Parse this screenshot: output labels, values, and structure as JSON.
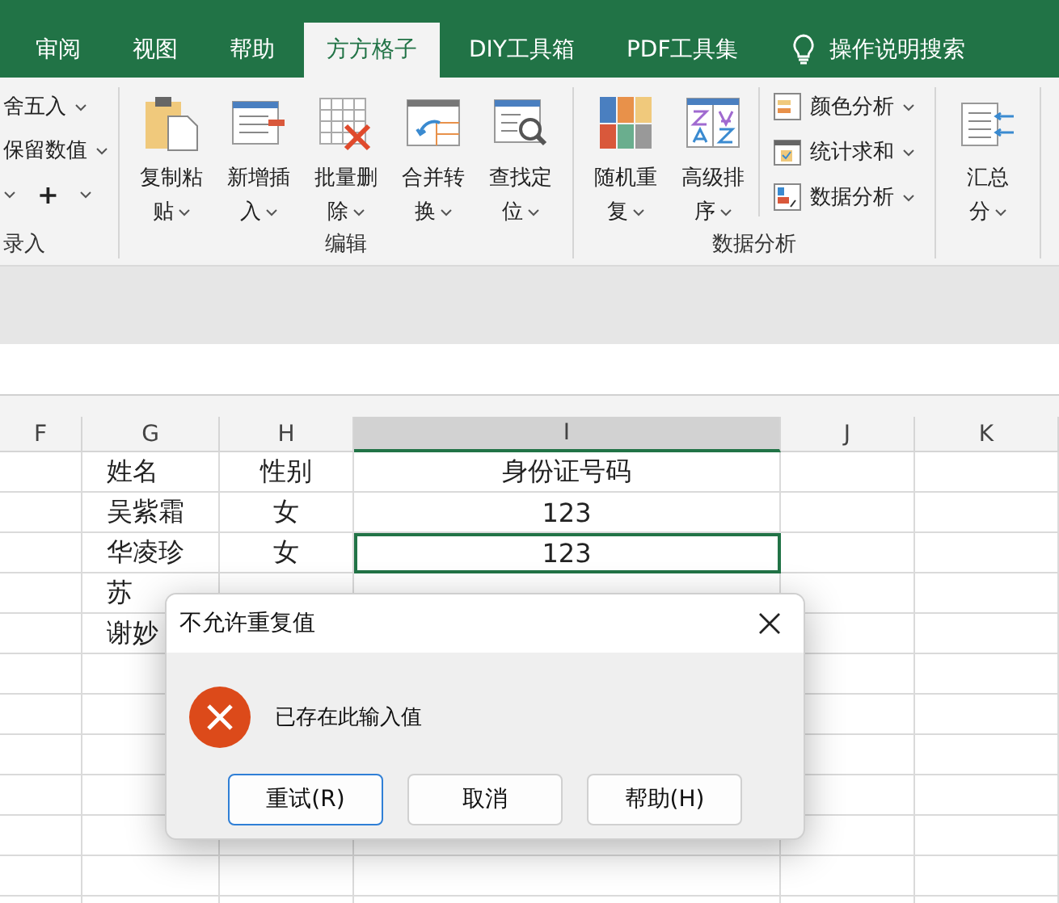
{
  "tabs": [
    {
      "label": "审阅",
      "selected": false
    },
    {
      "label": "视图",
      "selected": false
    },
    {
      "label": "帮助",
      "selected": false
    },
    {
      "label": "方方格子",
      "selected": true
    },
    {
      "label": "DIY工具箱",
      "selected": false
    },
    {
      "label": "PDF工具集",
      "selected": false
    }
  ],
  "search": {
    "label": "操作说明搜索"
  },
  "ribbon": {
    "groups": [
      {
        "label": "录入",
        "items": [
          {
            "kind": "small",
            "label": "舍五入"
          },
          {
            "kind": "small",
            "label": "保留数值"
          },
          {
            "kind": "symbol",
            "label": "+"
          }
        ]
      },
      {
        "label": "编辑",
        "items": [
          {
            "kind": "large",
            "lines": [
              "复制粘",
              "贴"
            ]
          },
          {
            "kind": "large",
            "lines": [
              "新增插",
              "入"
            ]
          },
          {
            "kind": "large",
            "lines": [
              "批量删",
              "除"
            ]
          },
          {
            "kind": "large",
            "lines": [
              "合并转",
              "换"
            ]
          },
          {
            "kind": "large",
            "lines": [
              "查找定",
              "位"
            ]
          }
        ]
      },
      {
        "label": "数据分析",
        "items": [
          {
            "kind": "large",
            "lines": [
              "随机重",
              "复"
            ]
          },
          {
            "kind": "large",
            "lines": [
              "高级排",
              "序"
            ]
          },
          {
            "kind": "stack",
            "items": [
              {
                "label": "颜色分析"
              },
              {
                "label": "统计求和"
              },
              {
                "label": "数据分析"
              }
            ]
          }
        ]
      },
      {
        "items": [
          {
            "kind": "large",
            "lines": [
              "汇总",
              "分"
            ]
          }
        ]
      }
    ]
  },
  "sheet": {
    "columns": [
      {
        "label": "F",
        "selected": false
      },
      {
        "label": "G",
        "selected": false
      },
      {
        "label": "H",
        "selected": false
      },
      {
        "label": "I",
        "selected": true
      },
      {
        "label": "J",
        "selected": false
      },
      {
        "label": "K",
        "selected": false
      }
    ],
    "rows": [
      {
        "cells": [
          {
            "selected": false
          },
          {
            "text": "姓名",
            "selected": false
          },
          {
            "text": "性别",
            "selected": false
          },
          {
            "text": "身份证号码",
            "selected": false
          },
          {
            "selected": false
          },
          {
            "selected": false
          }
        ]
      },
      {
        "cells": [
          {
            "selected": false
          },
          {
            "text": "吴紫霜",
            "selected": false
          },
          {
            "text": "女",
            "selected": false
          },
          {
            "text": "123",
            "selected": false
          },
          {
            "selected": false
          },
          {
            "selected": false
          }
        ]
      },
      {
        "cells": [
          {
            "selected": false
          },
          {
            "text": "华凌珍",
            "selected": false
          },
          {
            "text": "女",
            "selected": false
          },
          {
            "text": "123",
            "selected": true
          },
          {
            "selected": false
          },
          {
            "selected": false
          }
        ]
      },
      {
        "cells": [
          {
            "selected": false
          },
          {
            "text": "苏",
            "selected": false
          },
          {
            "selected": false
          },
          {
            "selected": false
          },
          {
            "selected": false
          },
          {
            "selected": false
          }
        ]
      },
      {
        "cells": [
          {
            "selected": false
          },
          {
            "text": "谢妙",
            "selected": false
          },
          {},
          {},
          {
            "selected": false
          },
          {
            "selected": false
          }
        ]
      }
    ]
  },
  "dialog": {
    "title": "不允许重复值",
    "message": "已存在此输入值",
    "buttons": [
      {
        "label": "重试(R)",
        "selected": true
      },
      {
        "label": "取消",
        "selected": false
      },
      {
        "label": "帮助(H)",
        "selected": false
      }
    ]
  }
}
